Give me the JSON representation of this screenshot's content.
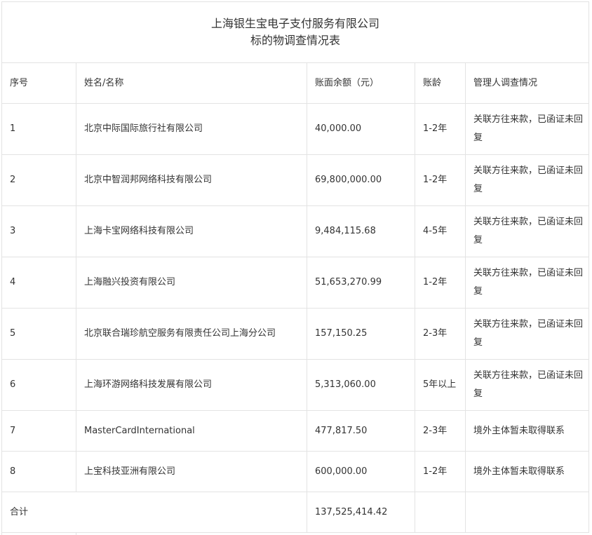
{
  "title": {
    "line1": "上海银生宝电子支付服务有限公司",
    "line2": "标的物调查情况表"
  },
  "headers": {
    "index": "序号",
    "name": "姓名/名称",
    "balance": "账面余额（元）",
    "aging": "账龄",
    "status": "管理人调查情况"
  },
  "rows": [
    {
      "index": "1",
      "name": "北京中际国际旅行社有限公司",
      "balance": "40,000.00",
      "aging": "1-2年",
      "status": "关联方往来款，已函证未回复"
    },
    {
      "index": "2",
      "name": "北京中智润邦网络科技有限公司",
      "balance": "69,800,000.00",
      "aging": "1-2年",
      "status": "关联方往来款，已函证未回复"
    },
    {
      "index": "3",
      "name": "上海卡宝网络科技有限公司",
      "balance": "9,484,115.68",
      "aging": "4-5年",
      "status": "关联方往来款，已函证未回复"
    },
    {
      "index": "4",
      "name": "上海融兴投资有限公司",
      "balance": "51,653,270.99",
      "aging": "1-2年",
      "status": "关联方往来款，已函证未回复"
    },
    {
      "index": "5",
      "name": "北京联合瑞珍航空服务有限责任公司上海分公司",
      "balance": "157,150.25",
      "aging": "2-3年",
      "status": "关联方往来款，已函证未回复"
    },
    {
      "index": "6",
      "name": "上海环游网络科技发展有限公司",
      "balance": "5,313,060.00",
      "aging": "5年以上",
      "status": "关联方往来款，已函证未回复"
    },
    {
      "index": "7",
      "name": "MasterCardInternational",
      "balance": "477,817.50",
      "aging": "2-3年",
      "status": "境外主体暂未取得联系"
    },
    {
      "index": "8",
      "name": "上宝科技亚洲有限公司",
      "balance": "600,000.00",
      "aging": "1-2年",
      "status": "境外主体暂未取得联系"
    }
  ],
  "total": {
    "label": "合计",
    "balance": "137,525,414.42"
  }
}
